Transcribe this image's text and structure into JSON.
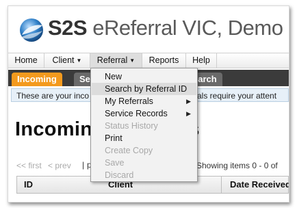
{
  "brand": {
    "prefix": "S2S",
    "title": "eReferral VIC, Demo"
  },
  "menubar": {
    "items": [
      {
        "label": "Home",
        "has_caret": false
      },
      {
        "label": "Client",
        "has_caret": true
      },
      {
        "label": "Referral",
        "has_caret": true,
        "active": true
      },
      {
        "label": "Reports",
        "has_caret": false
      },
      {
        "label": "Help",
        "has_caret": false
      }
    ],
    "caret_glyph": "▼"
  },
  "tabs": {
    "incoming": "Incoming",
    "second": "Ser",
    "search": "earch"
  },
  "notice": {
    "text": "These are your inco",
    "text_right": "rals require your attent"
  },
  "page_title": {
    "left": "Incomin",
    "right": "ls"
  },
  "pager": {
    "first": "<< first",
    "prev": "< prev",
    "pipe": "|",
    "p": "p",
    "showing": "Showing items 0 - 0 of"
  },
  "table": {
    "columns": [
      "ID",
      "Client",
      "Date Received"
    ]
  },
  "dropdown": {
    "items": [
      {
        "label": "New",
        "disabled": false,
        "submenu": false,
        "hover": false
      },
      {
        "label": "Search by Referral ID",
        "disabled": false,
        "submenu": false,
        "hover": true
      },
      {
        "label": "My Referrals",
        "disabled": false,
        "submenu": true,
        "hover": false
      },
      {
        "label": "Service Records",
        "disabled": false,
        "submenu": true,
        "hover": false
      },
      {
        "label": "Status History",
        "disabled": true,
        "submenu": false,
        "hover": false
      },
      {
        "label": "Print",
        "disabled": false,
        "submenu": false,
        "hover": false
      },
      {
        "label": "Create Copy",
        "disabled": true,
        "submenu": false,
        "hover": false
      },
      {
        "label": "Save",
        "disabled": true,
        "submenu": false,
        "hover": false
      },
      {
        "label": "Discard",
        "disabled": true,
        "submenu": false,
        "hover": false
      }
    ],
    "submenu_glyph": "▶"
  },
  "colors": {
    "accent_tab": "#f39a1e",
    "tab_bar": "#3b3b3b",
    "notice_bg": "#e7f0f8",
    "logo_blue": "#1d6fb8"
  }
}
